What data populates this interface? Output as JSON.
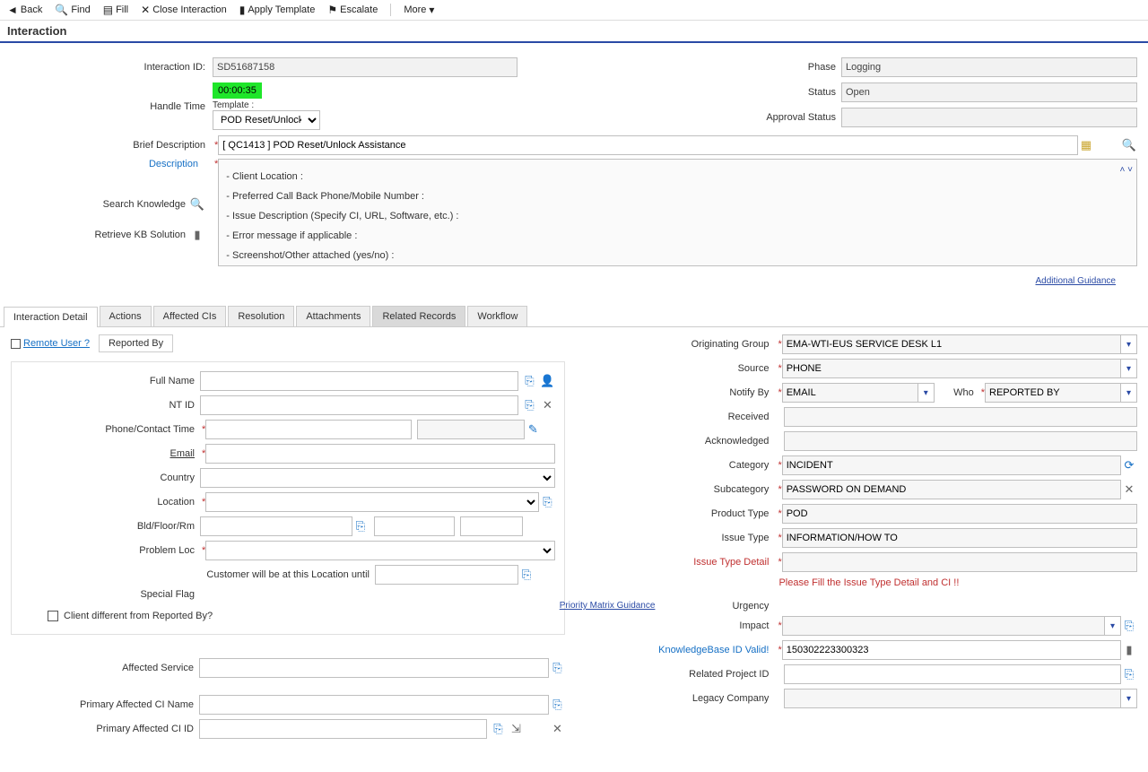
{
  "toolbar": {
    "back": "Back",
    "find": "Find",
    "fill": "Fill",
    "close_interaction": "Close Interaction",
    "apply_template": "Apply Template",
    "escalate": "Escalate",
    "more": "More"
  },
  "page_title": "Interaction",
  "header": {
    "interaction_id_label": "Interaction ID:",
    "interaction_id": "SD51687158",
    "handle_time_label": "Handle Time",
    "handle_time": "00:00:35",
    "template_label": "Template :",
    "template_select": "POD Reset/Unlock",
    "phase_label": "Phase",
    "phase": "Logging",
    "status_label": "Status",
    "status": "Open",
    "approval_status_label": "Approval Status",
    "approval_status": "",
    "brief_desc_label": "Brief Description",
    "brief_desc": "[ QC1413 ] POD Reset/Unlock Assistance",
    "description_label": "Description",
    "desc_lines": {
      "l1": "- Client Location :",
      "l2": "- Preferred Call Back Phone/Mobile Number :",
      "l3": "- Issue Description (Specify CI, URL, Software, etc.) :",
      "l4": "- Error message if applicable :",
      "l5": "- Screenshot/Other attached (yes/no) :"
    },
    "search_knowledge_label": "Search Knowledge",
    "retrieve_kb_label": "Retrieve KB Solution",
    "additional_guidance": "Additional Guidance"
  },
  "tabs": {
    "interaction_detail": "Interaction Detail",
    "actions": "Actions",
    "affected_cis": "Affected CIs",
    "resolution": "Resolution",
    "attachments": "Attachments",
    "related_records": "Related Records",
    "workflow": "Workflow"
  },
  "detail": {
    "remote_user": "Remote User ?",
    "reported_by": "Reported By",
    "full_name": "Full Name",
    "nt_id": "NT ID",
    "phone_contact": "Phone/Contact Time",
    "email": "Email",
    "country": "Country",
    "location": "Location",
    "bld_floor": "Bld/Floor/Rm",
    "problem_loc": "Problem Loc",
    "cust_at_loc": "Customer will be at this Location until",
    "special_flag": "Special Flag",
    "client_diff": "Client different from Reported By?",
    "affected_service": "Affected Service",
    "primary_ci_name": "Primary Affected CI Name",
    "primary_ci_id": "Primary Affected CI ID",
    "priority_matrix": "Priority Matrix Guidance"
  },
  "right": {
    "orig_group_label": "Originating Group",
    "orig_group": "EMA-WTI-EUS SERVICE DESK L1",
    "source_label": "Source",
    "source": "PHONE",
    "notify_by_label": "Notify By",
    "notify_by": "EMAIL",
    "who_label": "Who",
    "who": "REPORTED BY",
    "received_label": "Received",
    "received": "",
    "ack_label": "Acknowledged",
    "ack": "",
    "category_label": "Category",
    "category": "INCIDENT",
    "subcategory_label": "Subcategory",
    "subcategory": "PASSWORD ON DEMAND",
    "product_type_label": "Product Type",
    "product_type": "POD",
    "issue_type_label": "Issue Type",
    "issue_type": "INFORMATION/HOW TO",
    "issue_type_detail_label": "Issue Type Detail",
    "issue_type_detail": "",
    "warn": "Please Fill the Issue Type Detail and CI !!",
    "urgency_label": "Urgency",
    "impact_label": "Impact",
    "kb_valid_label": "KnowledgeBase ID Valid!",
    "kb_valid": "150302223300323",
    "related_proj_label": "Related Project ID",
    "legacy_label": "Legacy Company"
  }
}
